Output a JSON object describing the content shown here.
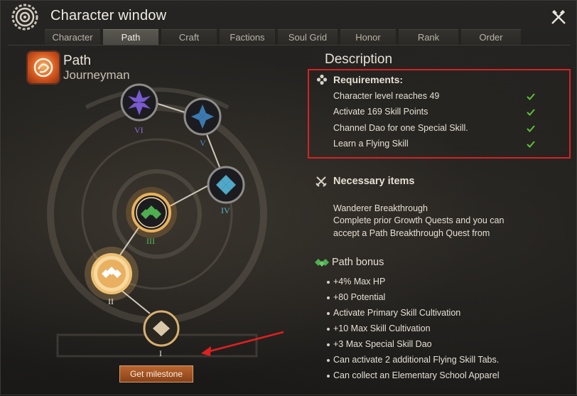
{
  "window": {
    "title": "Character window"
  },
  "tabs": [
    {
      "label": "Character",
      "active": false
    },
    {
      "label": "Path",
      "active": true
    },
    {
      "label": "Craft",
      "active": false
    },
    {
      "label": "Factions",
      "active": false
    },
    {
      "label": "Soul Grid",
      "active": false
    },
    {
      "label": "Honor",
      "active": false
    },
    {
      "label": "Rank",
      "active": false
    },
    {
      "label": "Order",
      "active": false
    }
  ],
  "path": {
    "title": "Path",
    "subtitle": "Journeyman"
  },
  "nodes": [
    {
      "numeral": "VI",
      "color": "#7a5ad0"
    },
    {
      "numeral": "V",
      "color": "#3a7ab0"
    },
    {
      "numeral": "IV",
      "color": "#4fa8c8"
    },
    {
      "numeral": "III",
      "color": "#4fae4f"
    },
    {
      "numeral": "II",
      "color": "#ffffff"
    },
    {
      "numeral": "I",
      "color": "#d8c8a8"
    }
  ],
  "milestone_button": "Get milestone",
  "description": {
    "title": "Description",
    "requirements": {
      "heading": "Requirements:",
      "items": [
        {
          "text": "Character level reaches 49",
          "met": true
        },
        {
          "text": "Activate 169 Skill Points",
          "met": true
        },
        {
          "text": "Channel Dao for one Special Skill.",
          "met": true
        },
        {
          "text": "Learn a Flying Skill",
          "met": true
        }
      ]
    },
    "necessary_items": {
      "heading": "Necessary items",
      "lines": [
        "Wanderer Breakthrough",
        "Complete prior Growth Quests and you can",
        "accept a Path Breakthrough Quest from"
      ]
    },
    "path_bonus": {
      "heading": "Path bonus",
      "items": [
        "+4% Max HP",
        "+80 Potential",
        "Activate Primary Skill Cultivation",
        "+10 Max Skill Cultivation",
        "+3 Max Special Skill Dao",
        "Can activate 2 additional Flying Skill Tabs.",
        "Can collect an Elementary School Apparel"
      ]
    }
  },
  "colors": {
    "highlight_box": "#d42323",
    "check": "#5fbf3a",
    "button": "#a6562a"
  }
}
